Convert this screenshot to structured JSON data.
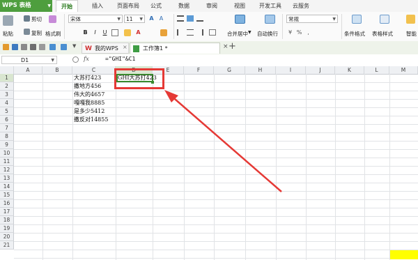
{
  "app": {
    "name": "WPS 表格"
  },
  "menu": {
    "tabs": [
      "开始",
      "插入",
      "页面布局",
      "公式",
      "数据",
      "审阅",
      "视图",
      "开发工具",
      "云服务"
    ],
    "active": "开始"
  },
  "ribbon": {
    "cut": "剪切",
    "copy": "复制",
    "paste": "粘贴",
    "format_painter": "格式刷",
    "font_name": "宋体",
    "font_size": "11",
    "bold": "B",
    "italic": "I",
    "underline": "U",
    "merge_center": "合并居中",
    "wrap_text": "自动换行",
    "number_format": "常规",
    "conditional_format": "条件格式",
    "table_style": "表格样式",
    "smart": "智能"
  },
  "doc_tabs": [
    {
      "label": "我的WPS"
    },
    {
      "label": "工作簿1 *"
    }
  ],
  "formula_bar": {
    "cell_ref": "D1",
    "fx": "fx",
    "formula": "=\"GHI\"&C1"
  },
  "columns": [
    "A",
    "B",
    "C",
    "D",
    "E",
    "F",
    "G",
    "H",
    "I",
    "J",
    "K",
    "L",
    "M"
  ],
  "rows": [
    "1",
    "2",
    "3",
    "4",
    "5",
    "6",
    "7",
    "8",
    "9",
    "10",
    "11",
    "12",
    "13",
    "14",
    "15",
    "16",
    "17",
    "18",
    "19",
    "20",
    "21"
  ],
  "cells": {
    "C": [
      "大苏打423",
      "撒地方456",
      "伟大的4657",
      "嘎嘎我8885",
      "是多少5412",
      "撒反对14855"
    ],
    "D1": "GHI大苏打423"
  },
  "colors": {
    "accent": "#4e9e3e",
    "highlight": "#e53935",
    "selected_cell": "#3a8a2e",
    "yellow_fill": "#ffff00"
  }
}
